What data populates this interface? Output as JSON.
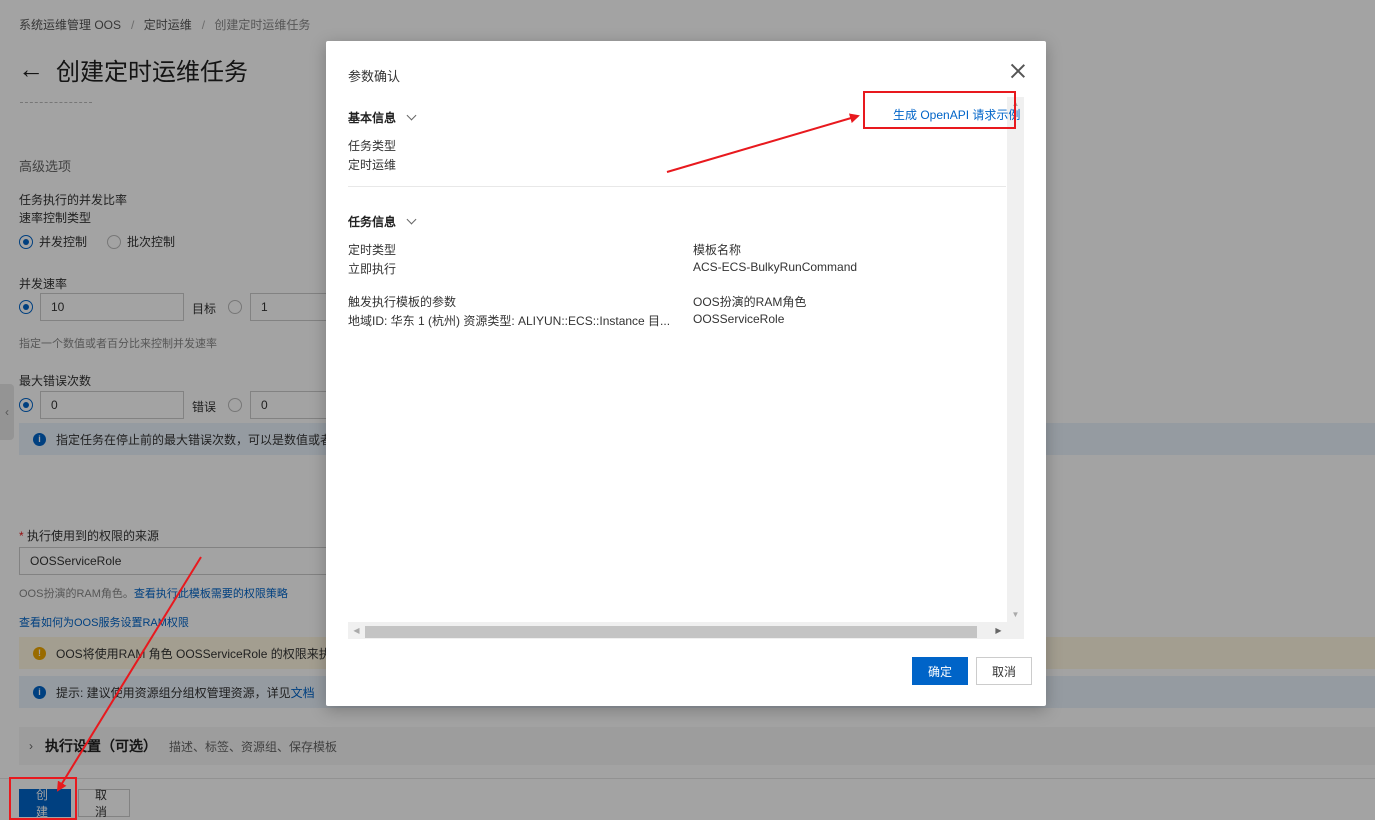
{
  "breadcrumb": [
    "系统运维管理 OOS",
    "定时运维",
    "创建定时运维任务"
  ],
  "page_title": "创建定时运维任务",
  "advanced": {
    "section_title": "高级选项",
    "concurrency_ratio_label": "任务执行的并发比率",
    "rate_control_type_label": "速率控制类型",
    "rate_options": [
      "并发控制",
      "批次控制"
    ],
    "concurrency_label": "并发速率",
    "concurrency_value": "10",
    "target_label": "目标",
    "concurrency_target_value": "1",
    "concurrency_hint": "指定一个数值或者百分比来控制并发速率",
    "max_errors_label": "最大错误次数",
    "max_errors_value": "0",
    "errors_label": "错误",
    "errors_target_value": "0",
    "max_errors_info": "指定任务在停止前的最大错误次数，可以是数值或者百分"
  },
  "permission": {
    "label": "执行使用到的权限的来源",
    "role_value": "OOSServiceRole",
    "role_hint_prefix": "OOS扮演的RAM角色。",
    "role_hint_link": "查看执行此模板需要的权限策略",
    "setup_link": "查看如何为OOS服务设置RAM权限",
    "warn_text": "OOS将使用RAM 角色 OOSServiceRole 的权限来执行步骤",
    "tip_prefix": "提示: 建议使用资源组分组权管理资源，详见",
    "tip_link": "文档"
  },
  "exec_settings": {
    "title": "执行设置（可选）",
    "desc": "描述、标签、资源组、保存模板"
  },
  "footer": {
    "create": "创建",
    "cancel": "取消"
  },
  "modal": {
    "title": "参数确认",
    "openapi_link": "生成 OpenAPI 请求示例",
    "basic_info": {
      "title": "基本信息",
      "task_type_label": "任务类型",
      "task_type_value": "定时运维"
    },
    "task_info": {
      "title": "任务信息",
      "schedule_type_label": "定时类型",
      "schedule_type_value": "立即执行",
      "template_name_label": "模板名称",
      "template_name_value": "ACS-ECS-BulkyRunCommand",
      "params_label": "触发执行模板的参数",
      "params_value": "地域ID: 华东 1 (杭州) 资源类型: ALIYUN::ECS::Instance 目...",
      "ram_role_label": "OOS扮演的RAM角色",
      "ram_role_value": "OOSServiceRole"
    },
    "confirm": "确定",
    "cancel": "取消"
  },
  "colors": {
    "primary": "#0064c8",
    "annotation_red": "#e8191e",
    "overlay": "rgba(0,0,0,0.36)"
  }
}
